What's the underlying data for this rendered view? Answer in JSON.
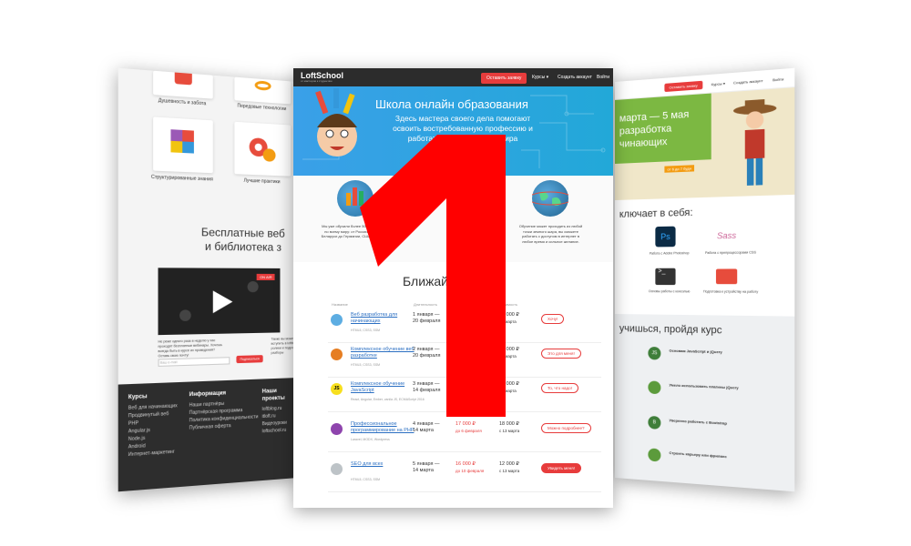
{
  "left_page": {
    "features": [
      {
        "label": "Душевность и забота"
      },
      {
        "label": "Передовые технологии"
      },
      {
        "label": "Структурированные знания"
      },
      {
        "label": "Лучшие практики"
      }
    ],
    "heading": "Бесплатные веб\nи библиотека з",
    "video_badge": "ON AIR",
    "text_left": "Не реже одного раза в неделю у нас проходят бесплатные вебинары. Хочешь всегда быть в курсе их проведения? Оставь свою почту!",
    "text_right": "Также вы можете вступить в loftblog.ru ролики и подробные разборы",
    "email_placeholder": "Ваш e-mail",
    "subscribe_button": "Подписаться",
    "footer": {
      "col1_title": "Курсы",
      "col1_items": [
        "Веб для начинающих",
        "Продвинутый веб",
        "PHP",
        "Angular.js",
        "Node.js",
        "Android",
        "Интернет-маркетинг"
      ],
      "col2_title": "Информация",
      "col2_items": [
        "Наши партнёры",
        "Партнёрская программа",
        "Политика конфиденциальности",
        "Публичная оферта"
      ],
      "col3_title": "Наши проекты",
      "col3_items": [
        "loftblog.ru",
        "itloft.ru",
        "Видеоуроки",
        "loftschool.ru"
      ]
    }
  },
  "center_page": {
    "logo": "LoftSchool",
    "logo_sub": "от мастеров к студентам",
    "nav_button": "Оставить заявку",
    "nav_courses": "Курсы ▾",
    "nav_create": "Создать аккаунт",
    "nav_login": "Войти",
    "hero_title": "Школа онлайн образования",
    "hero_text": "Здесь мастера своего дела помогают освоить востребованную профессию и работать из любой точки мира",
    "features": [
      {
        "text": "Мы уже обучили более 5000 студентов по всему миру: от России, Украины, Беларуси до Германии, США и Канады."
      },
      {
        "text": ""
      },
      {
        "text": ""
      },
      {
        "text": "Обучение может проходить из любой точки земного шара, вы сможете работать с доступом в интернет в любое время и сильное желание."
      }
    ],
    "schedule_title": "Ближай",
    "table_headers": [
      "Название",
      "Длительность",
      "",
      "Стоимость",
      ""
    ],
    "courses": [
      {
        "name": "Веб разработка для начинающих",
        "tags": "HTML5, CSS3, SSM",
        "dates": "1 января —\n20 февраля",
        "price1": "",
        "price1_note": "",
        "price2": "13 000 ₽",
        "price2_note": "15 марта",
        "action": "Хочу!"
      },
      {
        "name": "Комплексное обучение веб разработке",
        "tags": "HTML5, CSS3, SSM",
        "dates": "2 января —\n20 февраля",
        "price1": "",
        "price1_note": "",
        "price2": "18 000 ₽",
        "price2_note": "15 марта",
        "action": "Это для меня!"
      },
      {
        "name": "Комплексное обучение JavaScript",
        "tags": "React, Angular, Ember, vanila JS, ECMAScript 2016",
        "dates": "3 января —\n14 февраля",
        "price1": "",
        "price1_note": "",
        "price2": "20 000 ₽",
        "price2_note": "13 марта",
        "action": "То, что надо!"
      },
      {
        "name": "Профессиональное программирование на PHP",
        "tags": "Laravel, MODX, Wordpress",
        "dates": "4 января —\n14 марта",
        "price1": "17 000 ₽",
        "price1_note": "до 6 февраля",
        "price2": "18 000 ₽",
        "price2_note": "с 13 марта",
        "action": "Можно подробнее?"
      },
      {
        "name": "SEO для всех",
        "tags": "HTML5, CSS3, SSM",
        "dates": "5 января —\n14 марта",
        "price1": "16 000 ₽",
        "price1_note": "до 10 февраля",
        "price2": "12 000 ₽",
        "price2_note": "с 13 марта",
        "action": "Увидеть меня!"
      }
    ]
  },
  "right_page": {
    "nav_button": "Оставить заявку",
    "nav_courses": "Курсы ▾",
    "nav_create": "Создать аккаунт",
    "nav_login": "Войти",
    "hero_title": "марта — 5 мая\nразработка\nчинающих",
    "hero_badge": "от 6 до 7 будн",
    "includes_title": "ключает в себя:",
    "tools": [
      {
        "label": "Работа с Adobe Photoshop"
      },
      {
        "label": "Работа с препроцессорами CSS"
      },
      {
        "label": "Основы работы с консолью"
      },
      {
        "label": "Подготовка к устройству на работу"
      }
    ],
    "learn_title": "учишься, пройдя курс",
    "skills": [
      {
        "icon": "JS",
        "title": "Основам JavaScript и jQuery"
      },
      {
        "icon": "",
        "title": "Умело использовать плагины jQuery"
      },
      {
        "icon": "B",
        "title": "Уверенно работать с Bootstrap"
      },
      {
        "icon": "",
        "title": "Строить карьеру или фриланс"
      }
    ]
  },
  "overlay": {
    "number": "1"
  },
  "colors": {
    "accent_red": "#e73c3c",
    "hero_blue": "#2aa4e0",
    "dark_nav": "#2c2c2c"
  }
}
